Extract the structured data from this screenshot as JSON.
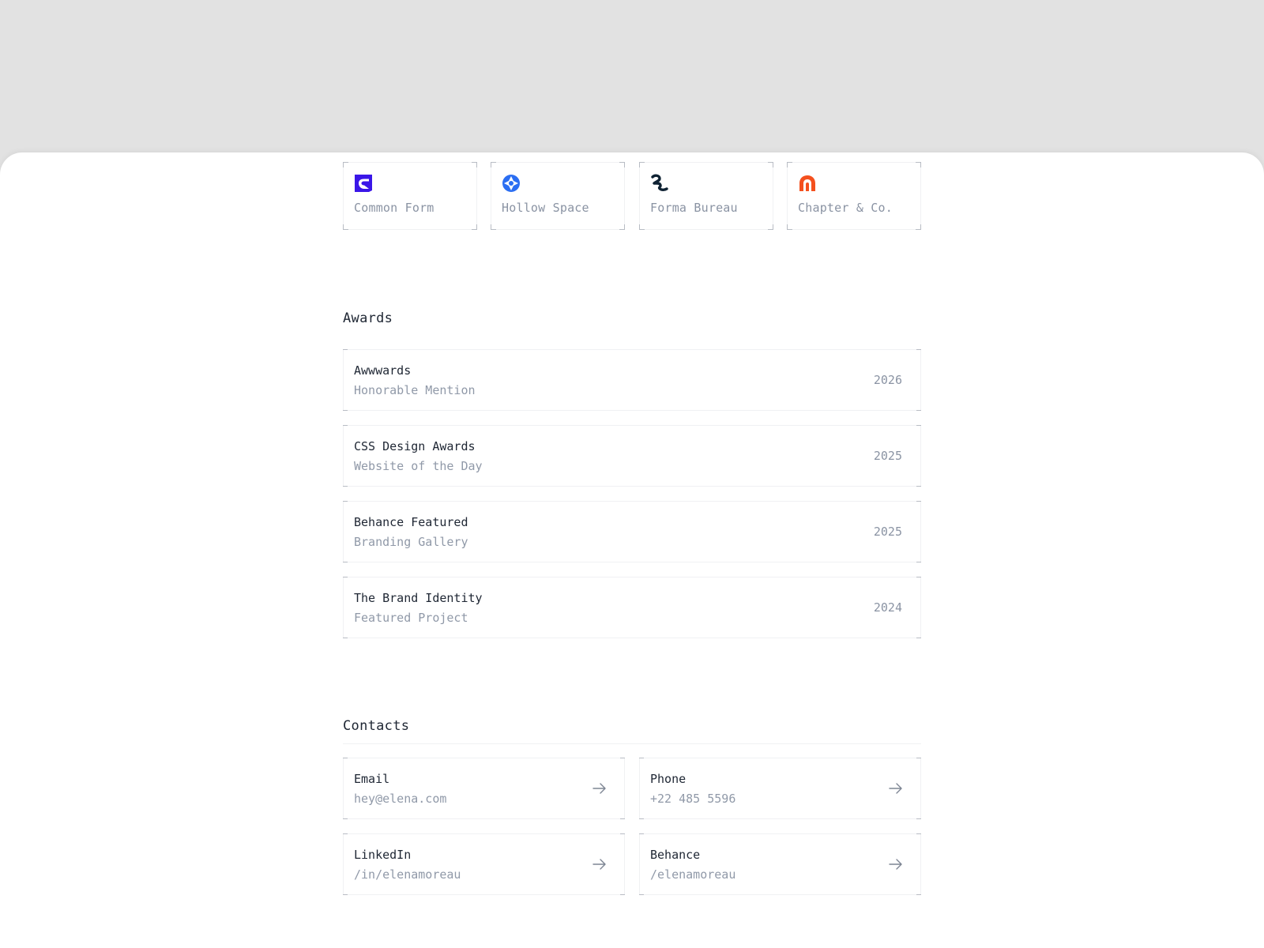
{
  "clients": [
    {
      "name": "Common Form",
      "icon": "common-form-logo-icon",
      "color": "#3a16e8"
    },
    {
      "name": "Hollow Space",
      "icon": "hollow-space-logo-icon",
      "color": "#2b6ef2"
    },
    {
      "name": "Forma Bureau",
      "icon": "forma-bureau-logo-icon",
      "color": "#0f2233"
    },
    {
      "name": "Chapter & Co.",
      "icon": "chapter-co-logo-icon",
      "color": "#f4501e"
    }
  ],
  "awards": {
    "title": "Awards",
    "items": [
      {
        "name": "Awwwards",
        "detail": "Honorable Mention",
        "year": "2026"
      },
      {
        "name": "CSS Design Awards",
        "detail": "Website of the Day",
        "year": "2025"
      },
      {
        "name": "Behance Featured",
        "detail": "Branding Gallery",
        "year": "2025"
      },
      {
        "name": "The Brand Identity",
        "detail": "Featured Project",
        "year": "2024"
      }
    ]
  },
  "contacts": {
    "title": "Contacts",
    "items": [
      {
        "label": "Email",
        "value": "hey@elena.com",
        "icon": "arrow-right-icon"
      },
      {
        "label": "Phone",
        "value": "+22 485 5596",
        "icon": "arrow-right-icon"
      },
      {
        "label": "LinkedIn",
        "value": "/in/elenamoreau",
        "icon": "arrow-right-icon"
      },
      {
        "label": "Behance",
        "value": "/elenamoreau",
        "icon": "arrow-right-icon"
      }
    ]
  }
}
